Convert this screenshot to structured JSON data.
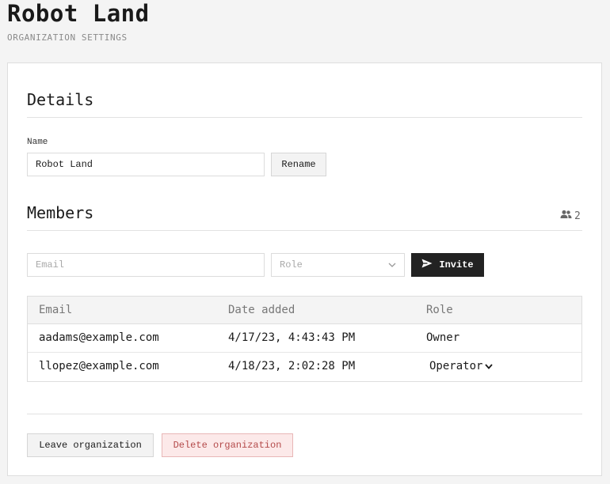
{
  "page": {
    "title": "Robot Land",
    "subtitle": "ORGANIZATION SETTINGS"
  },
  "details": {
    "section_title": "Details",
    "name_label": "Name",
    "name_value": "Robot Land",
    "rename_label": "Rename"
  },
  "members": {
    "section_title": "Members",
    "count": "2",
    "email_placeholder": "Email",
    "role_placeholder": "Role",
    "invite_label": "Invite",
    "table": {
      "columns": [
        "Email",
        "Date added",
        "Role"
      ],
      "rows": [
        {
          "email": "aadams@example.com",
          "date_added": "4/17/23, 4:43:43 PM",
          "role": "Owner",
          "role_editable": false
        },
        {
          "email": "llopez@example.com",
          "date_added": "4/18/23, 2:02:28 PM",
          "role": "Operator",
          "role_editable": true
        }
      ]
    }
  },
  "footer": {
    "leave_label": "Leave organization",
    "delete_label": "Delete organization"
  },
  "icons": {
    "members_count": "people-icon",
    "invite": "send-icon",
    "role_dropdown": "chevron-down-icon"
  },
  "colors": {
    "primary_button": "#222222",
    "danger_text": "#b44a4a",
    "danger_bg": "#fce9e9"
  }
}
